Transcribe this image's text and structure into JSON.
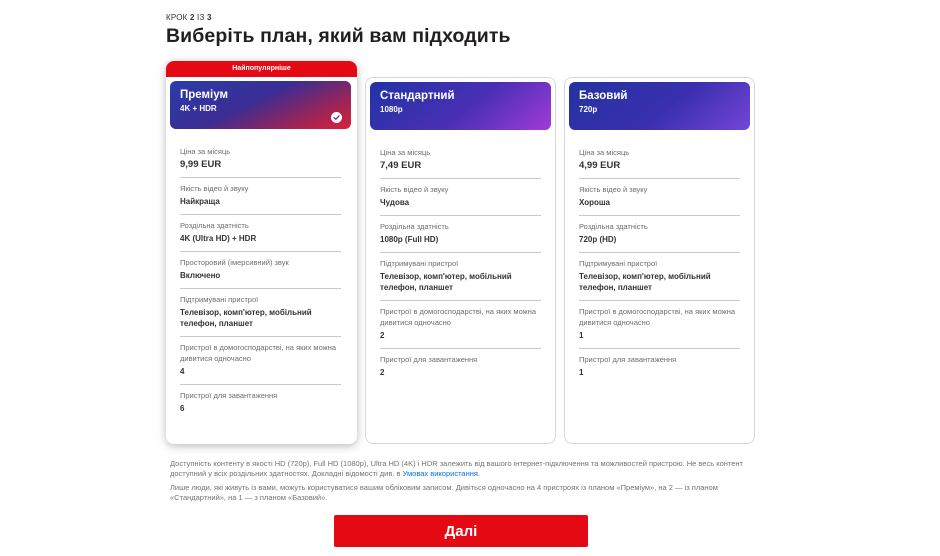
{
  "step": {
    "prefix": "КРОК",
    "current": "2",
    "separator": "ІЗ",
    "total": "3"
  },
  "title": "Виберіть план, який вам підходить",
  "plans": [
    {
      "badge": "Найпопулярніше",
      "name": "Преміум",
      "resolution": "4K + HDR",
      "selected": true,
      "attributes": [
        {
          "label": "Ціна за місяць",
          "value": "9,99 EUR"
        },
        {
          "label": "Якість відео й звуку",
          "value": "Найкраща"
        },
        {
          "label": "Роздільна здатність",
          "value": "4K (Ultra HD) + HDR"
        },
        {
          "label": "Просторовий (імерсивний) звук",
          "value": "Включено"
        },
        {
          "label": "Підтримувані пристрої",
          "value": "Телевізор, комп'ютер, мобільний телефон, планшет"
        },
        {
          "label": "Пристрої в домогосподарстві, на яких можна дивитися одночасно",
          "value": "4"
        },
        {
          "label": "Пристрої для завантаження",
          "value": "6"
        }
      ]
    },
    {
      "name": "Стандартний",
      "resolution": "1080p",
      "selected": false,
      "attributes": [
        {
          "label": "Ціна за місяць",
          "value": "7,49 EUR"
        },
        {
          "label": "Якість відео й звуку",
          "value": "Чудова"
        },
        {
          "label": "Роздільна здатність",
          "value": "1080p (Full HD)"
        },
        {
          "label": "Підтримувані пристрої",
          "value": "Телевізор, комп'ютер, мобільний телефон, планшет"
        },
        {
          "label": "Пристрої в домогосподарстві, на яких можна дивитися одночасно",
          "value": "2"
        },
        {
          "label": "Пристрої для завантаження",
          "value": "2"
        }
      ]
    },
    {
      "name": "Базовий",
      "resolution": "720p",
      "selected": false,
      "attributes": [
        {
          "label": "Ціна за місяць",
          "value": "4,99 EUR"
        },
        {
          "label": "Якість відео й звуку",
          "value": "Хороша"
        },
        {
          "label": "Роздільна здатність",
          "value": "720p (HD)"
        },
        {
          "label": "Підтримувані пристрої",
          "value": "Телевізор, комп'ютер, мобільний телефон, планшет"
        },
        {
          "label": "Пристрої в домогосподарстві, на яких можна дивитися одночасно",
          "value": "1"
        },
        {
          "label": "Пристрої для завантаження",
          "value": "1"
        }
      ]
    }
  ],
  "notes": {
    "availability": "Доступність контенту в якості HD (720p), Full HD (1080p), Ultra HD (4K) і HDR залежить від вашого інтернет-підключення та можливостей пристрою. Не весь контент доступний у всіх роздільних здатностях. Докладні відомості див. в",
    "terms_link": "Умовах використання",
    "terms_suffix": ".",
    "household": "Лише люди, які живуть із вами, можуть користуватися вашим обліковим записом. Дивіться одночасно на 4 пристроях із планом «Преміум», на 2 — із планом «Стандартний», на 1 — з планом «Базовий»."
  },
  "next_button": "Далі",
  "colors": {
    "accent": "#e50914",
    "link": "#0071eb"
  },
  "icons": {
    "selected": "check-circle-icon"
  }
}
